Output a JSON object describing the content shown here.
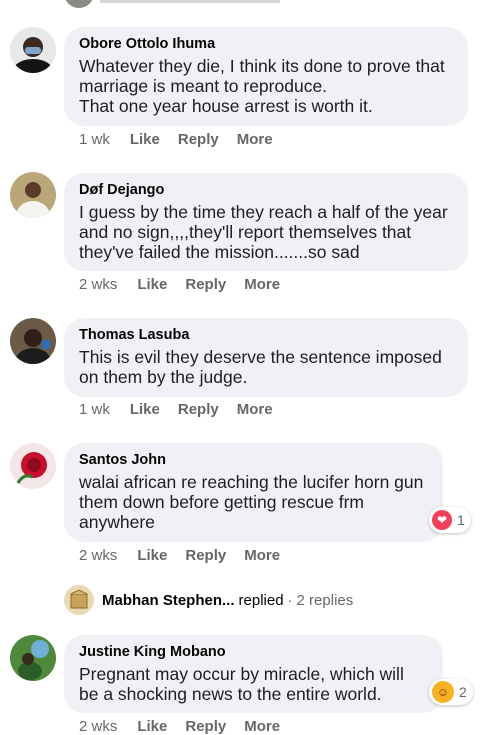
{
  "comments": [
    {
      "author": "Obore Ottolo Ihuma",
      "text": "Whatever they die, I think its done to prove that marriage is meant to reproduce.",
      "text2": "That one year house arrest is worth it.",
      "time": "1 wk",
      "like": "Like",
      "reply": "Reply",
      "more": "More",
      "avatar_icon": "person-mask-avatar"
    },
    {
      "author": "Døf Dejango",
      "text": "I guess by the time they reach a half of the year and no sign,,,,they'll report themselves that they've failed the mission.......so sad",
      "time": "2 wks",
      "like": "Like",
      "reply": "Reply",
      "more": "More",
      "avatar_icon": "person-white-shirt-avatar"
    },
    {
      "author": "Thomas Lasuba",
      "text": "This is evil they deserve the sentence imposed on them by the judge.",
      "time": "1 wk",
      "like": "Like",
      "reply": "Reply",
      "more": "More",
      "avatar_icon": "person-dark-avatar"
    },
    {
      "author": "Santos John",
      "text": "walai african re reaching the lucifer horn gun them down before getting rescue frm anywhere",
      "time": "2 wks",
      "like": "Like",
      "reply": "Reply",
      "more": "More",
      "reaction_count": "1",
      "reaction_icon": "love-heart-icon",
      "avatar_icon": "red-rose-avatar"
    },
    {
      "author": "Justine King Mobano",
      "text": "Pregnant may occur by miracle, which will be a shocking news to the entire world.",
      "time": "2 wks",
      "like": "Like",
      "reply": "Reply",
      "more": "More",
      "reaction_count": "2",
      "reaction_icon": "haha-laugh-icon",
      "avatar_icon": "person-green-avatar"
    }
  ],
  "reply_summary": {
    "name": "Mabhan Stephen...",
    "replied": "replied",
    "dot": "·",
    "count": "2 replies"
  },
  "colors": {
    "bubble": "#eff1f4",
    "meta_text": "#65676b",
    "heart": "#f33e58",
    "haha": "#f7b125"
  }
}
